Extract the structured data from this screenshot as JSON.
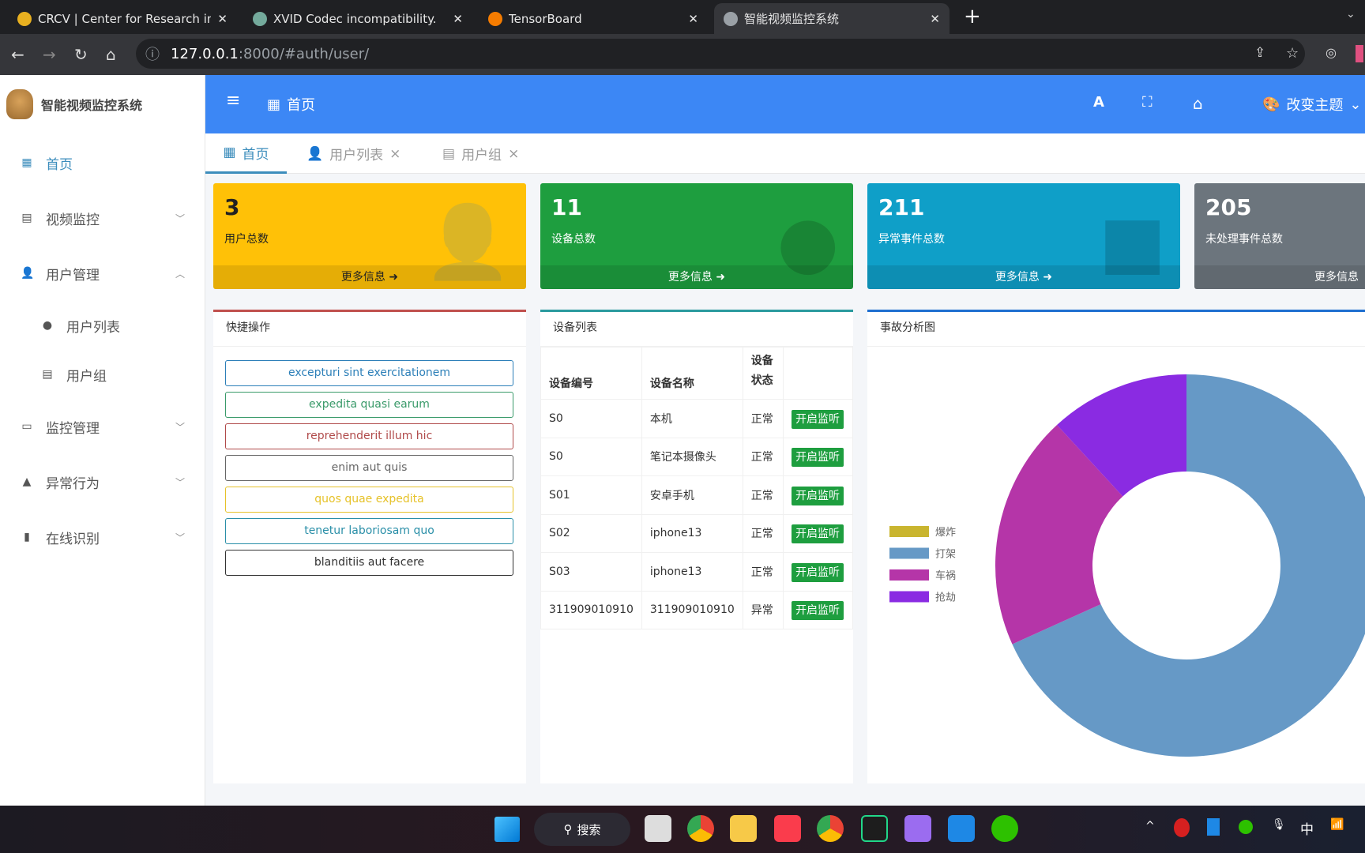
{
  "browser": {
    "tabs": [
      {
        "title": "CRCV | Center for Research in",
        "color": "#e8b020"
      },
      {
        "title": "XVID Codec incompatibility.",
        "color": "#74aa9c"
      },
      {
        "title": "TensorBoard",
        "color": "#f57c00"
      },
      {
        "title": "智能视频监控系统",
        "color": "#9aa0a6"
      }
    ],
    "new_tab": "+",
    "url_host": "127.0.0.1",
    "url_rest": ":8000/#auth/user/"
  },
  "sidebar": {
    "brand": "智能视频监控系统",
    "items": [
      {
        "label": "首页",
        "icon": "▦"
      },
      {
        "label": "视频监控",
        "icon": "▤",
        "chev": "﹀"
      },
      {
        "label": "用户管理",
        "icon": "👤",
        "chev": "︿"
      },
      {
        "label": "用户列表",
        "icon": "●"
      },
      {
        "label": "用户组",
        "icon": "▤"
      },
      {
        "label": "监控管理",
        "icon": "▭",
        "chev": "﹀"
      },
      {
        "label": "异常行为",
        "icon": "▲",
        "chev": "﹀"
      },
      {
        "label": "在线识别",
        "icon": "▮",
        "chev": "﹀"
      }
    ]
  },
  "header": {
    "menu": "≡",
    "home_label": "首页",
    "theme_label": "改变主题"
  },
  "page_tabs": [
    {
      "label": "首页"
    },
    {
      "label": "用户列表",
      "close": "×"
    },
    {
      "label": "用户组",
      "close": "×"
    }
  ],
  "cards": [
    {
      "num": "3",
      "label": "用户总数",
      "more": "更多信息 ➜",
      "color": "#ffc107"
    },
    {
      "num": "11",
      "label": "设备总数",
      "more": "更多信息 ➜",
      "color": "#1e9e3f"
    },
    {
      "num": "211",
      "label": "异常事件总数",
      "more": "更多信息 ➜",
      "color": "#0f9fc8"
    },
    {
      "num": "205",
      "label": "未处理事件总数",
      "more": "更多信息",
      "color": "#6c757d"
    }
  ],
  "quick": {
    "title": "快捷操作",
    "buttons": [
      {
        "label": "excepturi sint exercitationem",
        "color": "#2c7fb8"
      },
      {
        "label": "expedita quasi earum",
        "color": "#3a9a6a"
      },
      {
        "label": "reprehenderit illum hic",
        "color": "#b04a4a"
      },
      {
        "label": "enim aut quis",
        "color": "#666666"
      },
      {
        "label": "quos quae expedita",
        "color": "#e6c229"
      },
      {
        "label": "tenetur laboriosam quo",
        "color": "#2a8fa8"
      },
      {
        "label": "blanditiis aut facere",
        "color": "#333333"
      }
    ]
  },
  "devices": {
    "title": "设备列表",
    "columns": [
      "设备编号",
      "设备名称",
      "设备状态",
      ""
    ],
    "action": "开启监听",
    "rows": [
      [
        "S0",
        "本机",
        "正常"
      ],
      [
        "S0",
        "笔记本摄像头",
        "正常"
      ],
      [
        "S01",
        "安卓手机",
        "正常"
      ],
      [
        "S02",
        "iphone13",
        "正常"
      ],
      [
        "S03",
        "iphone13",
        "正常"
      ],
      [
        "311909010910",
        "311909010910",
        "异常"
      ]
    ]
  },
  "chart_data": {
    "type": "pie",
    "title": "事故分析图",
    "legend_position": "left",
    "categories": [
      "爆炸",
      "打架",
      "车祸",
      "抢劫"
    ],
    "values": [
      0,
      144,
      42,
      25
    ],
    "colors": [
      "#c9b52f",
      "#6699c6",
      "#b535a8",
      "#8a2be2"
    ]
  },
  "taskbar": {
    "search": "搜索",
    "ime": "中"
  }
}
